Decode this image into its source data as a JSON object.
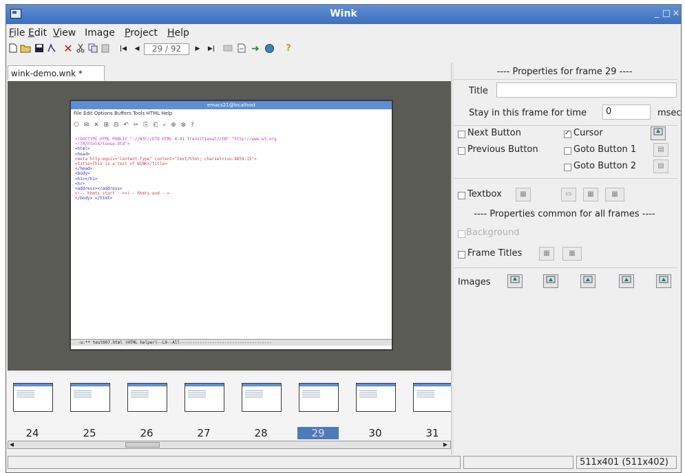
{
  "window": {
    "title": "Wink",
    "controls": [
      "_",
      "□",
      "×"
    ]
  },
  "menu": [
    {
      "label": "File",
      "key": "F",
      "rest": "ile"
    },
    {
      "label": "Edit",
      "key": "E",
      "rest": "dit"
    },
    {
      "label": "View",
      "key": "V",
      "rest": "iew"
    },
    {
      "label": "Image",
      "key": "",
      "rest": "Image"
    },
    {
      "label": "Project",
      "key": "P",
      "rest": "roject"
    },
    {
      "label": "Help",
      "key": "H",
      "rest": "elp"
    }
  ],
  "toolbar": {
    "frame_counter": "29 / 92"
  },
  "tab": {
    "label": "wink-demo.wnk *"
  },
  "inner_window": {
    "title": "emacs21@localhost",
    "menu": "File  Edit  Options  Buffers  Tools  HTML  Help",
    "tools": "⎔ ✉ ✕ ⊞ ⊟ ↶ ✂ ⎘ ⎗ ⌕ ⊕ ⊗ ?",
    "code_lines": [
      {
        "text": "<!DOCTYPE HTML PUBLIC \"-//W3C//DTD HTML 4.01 Transitional//EN\" \"http://www.w3.org",
        "color": "#b4b"
      },
      {
        "text": "<!TR/html4/loose.dtd\">",
        "color": "#b4b"
      },
      {
        "text": "<html>",
        "color": "#33c"
      },
      {
        "text": "<head>",
        "color": "#33c"
      },
      {
        "text": "<meta http-equiv=\"Content-Type\" content=\"text/html; charset=iso-8859-15\">",
        "color": "#c44"
      },
      {
        "text": "<title>This is a test of WINK</title>",
        "color": "#c44"
      },
      {
        "text": "</head>",
        "color": "#33c"
      },
      {
        "text": " ",
        "color": "#333"
      },
      {
        "text": "<body>",
        "color": "#33c"
      },
      {
        "text": "<h1></h1>",
        "color": "#33c"
      },
      {
        "text": " ",
        "color": "#333"
      },
      {
        "text": " ",
        "color": "#333"
      },
      {
        "text": " ",
        "color": "#333"
      },
      {
        "text": " ",
        "color": "#333"
      },
      {
        "text": "<hr>",
        "color": "#33c"
      },
      {
        "text": "<address></address>",
        "color": "#33c"
      },
      {
        "text": "<!-- hhmts start --><!-- hhmts end -->",
        "color": "#c44"
      },
      {
        "text": "</body> </html>",
        "color": "#33c"
      }
    ],
    "status": "-u:**  test007.html        (HTML helper)--L9--All-------------------------------------"
  },
  "filmstrip": {
    "frames": [
      "24",
      "25",
      "26",
      "27",
      "28",
      "29",
      "30",
      "31"
    ],
    "selected": "29"
  },
  "statusbar": {
    "left": "",
    "middle": "",
    "right": "511x401 (511x402)"
  },
  "properties": {
    "frame_header": "---- Properties for frame 29 ----",
    "title_label": "Title",
    "title_value": "",
    "stay_label": "Stay in this frame for time",
    "stay_value": "0",
    "stay_unit": "msec",
    "next_button": "Next Button",
    "cursor": "Cursor",
    "previous_button": "Previous Button",
    "goto1": "Goto Button 1",
    "goto2": "Goto Button 2",
    "textbox": "Textbox",
    "common_header": "---- Properties common for all frames ----",
    "background": "Background",
    "frame_titles": "Frame Titles",
    "images": "Images"
  }
}
